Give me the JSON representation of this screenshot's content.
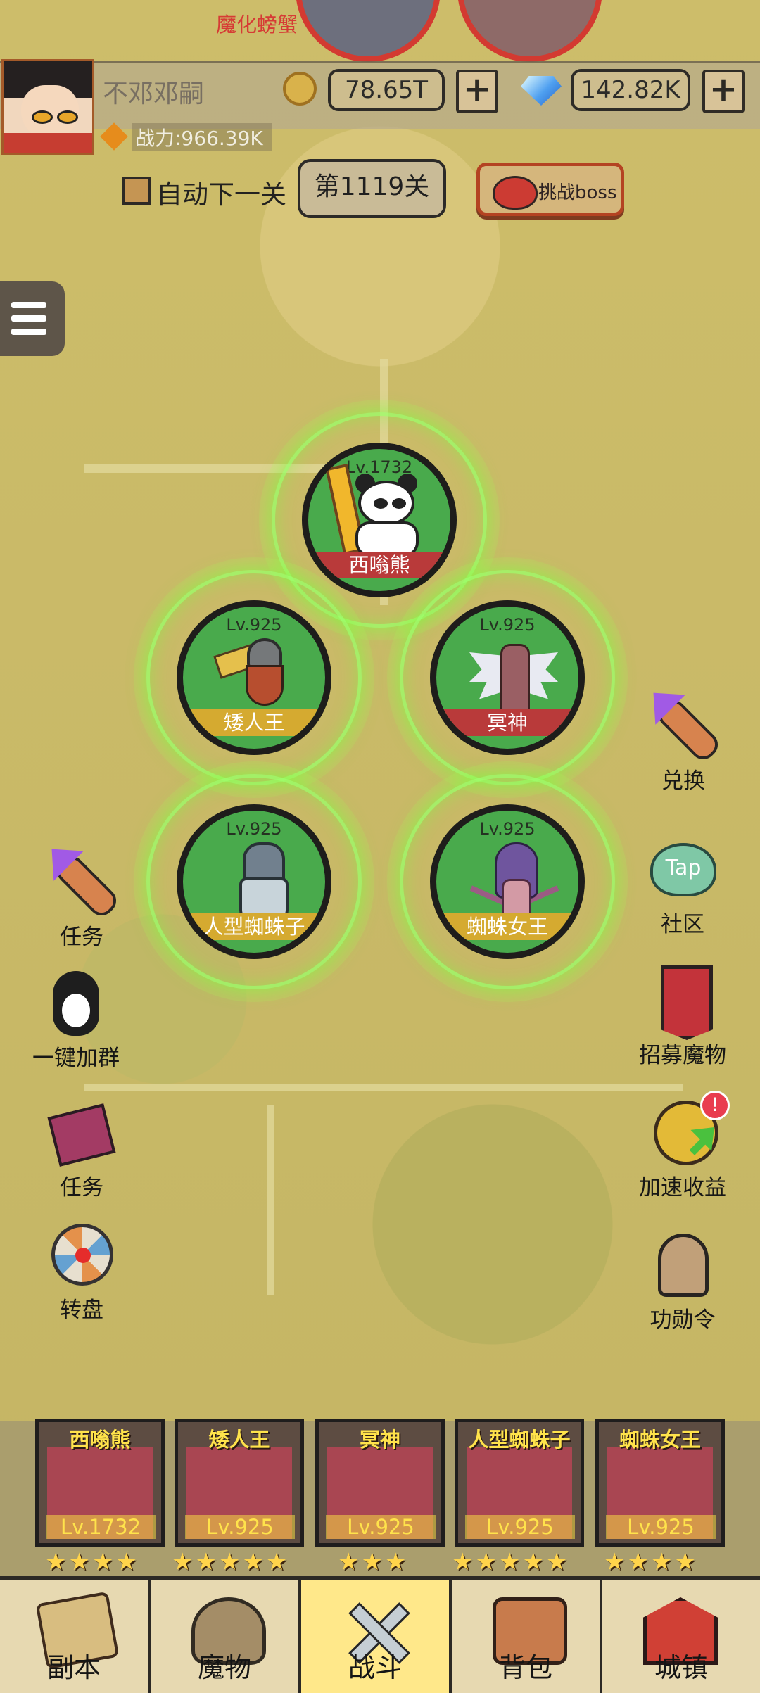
{
  "top": {
    "bonus_label": "魔化螃蟹"
  },
  "profile": {
    "name": "不邓邓嗣",
    "power": "战力:966.39K",
    "gold": "78.65T",
    "gems": "142.82K",
    "plus": "+"
  },
  "stage": {
    "auto_next": "自动下一关",
    "level": "第1119关",
    "boss": "挑战boss"
  },
  "units": [
    {
      "name": "西嗡熊",
      "level": "Lv.1732",
      "name_color": "red"
    },
    {
      "name": "矮人王",
      "level": "Lv.925",
      "name_color": "gold"
    },
    {
      "name": "冥神",
      "level": "Lv.925",
      "name_color": "red"
    },
    {
      "name": "人型蜘蛛子",
      "level": "Lv.925",
      "name_color": "gold"
    },
    {
      "name": "蜘蛛女王",
      "level": "Lv.925",
      "name_color": "gold"
    }
  ],
  "left_menu": [
    {
      "label": "任务",
      "icon": "rocket-icon"
    },
    {
      "label": "一键加群",
      "icon": "penguin-icon"
    },
    {
      "label": "任务",
      "icon": "book-icon"
    },
    {
      "label": "转盘",
      "icon": "wheel-icon"
    }
  ],
  "right_menu": [
    {
      "label": "兑换",
      "icon": "rocket-icon"
    },
    {
      "label": "社区",
      "icon": "tap-icon",
      "icon_text": "Tap"
    },
    {
      "label": "招募魔物",
      "icon": "banner-icon"
    },
    {
      "label": "加速收益",
      "icon": "coin-arrow-icon",
      "alert": "!"
    },
    {
      "label": "功勋令",
      "icon": "helmet-icon"
    }
  ],
  "roster": [
    {
      "name": "西嗡熊",
      "level": "Lv.1732",
      "stars": "★★★★"
    },
    {
      "name": "矮人王",
      "level": "Lv.925",
      "stars": "★★★★★"
    },
    {
      "name": "冥神",
      "level": "Lv.925",
      "stars": "★★★"
    },
    {
      "name": "人型蜘蛛子",
      "level": "Lv.925",
      "stars": "★★★★★"
    },
    {
      "name": "蜘蛛女王",
      "level": "Lv.925",
      "stars": "★★★★"
    }
  ],
  "bottom_nav": [
    {
      "label": "副本"
    },
    {
      "label": "魔物"
    },
    {
      "label": "战斗"
    },
    {
      "label": "背包"
    },
    {
      "label": "城镇"
    }
  ],
  "colors": {
    "accent": "#ffe88a",
    "background": "#c9b964",
    "glow": "#9aff5b"
  }
}
